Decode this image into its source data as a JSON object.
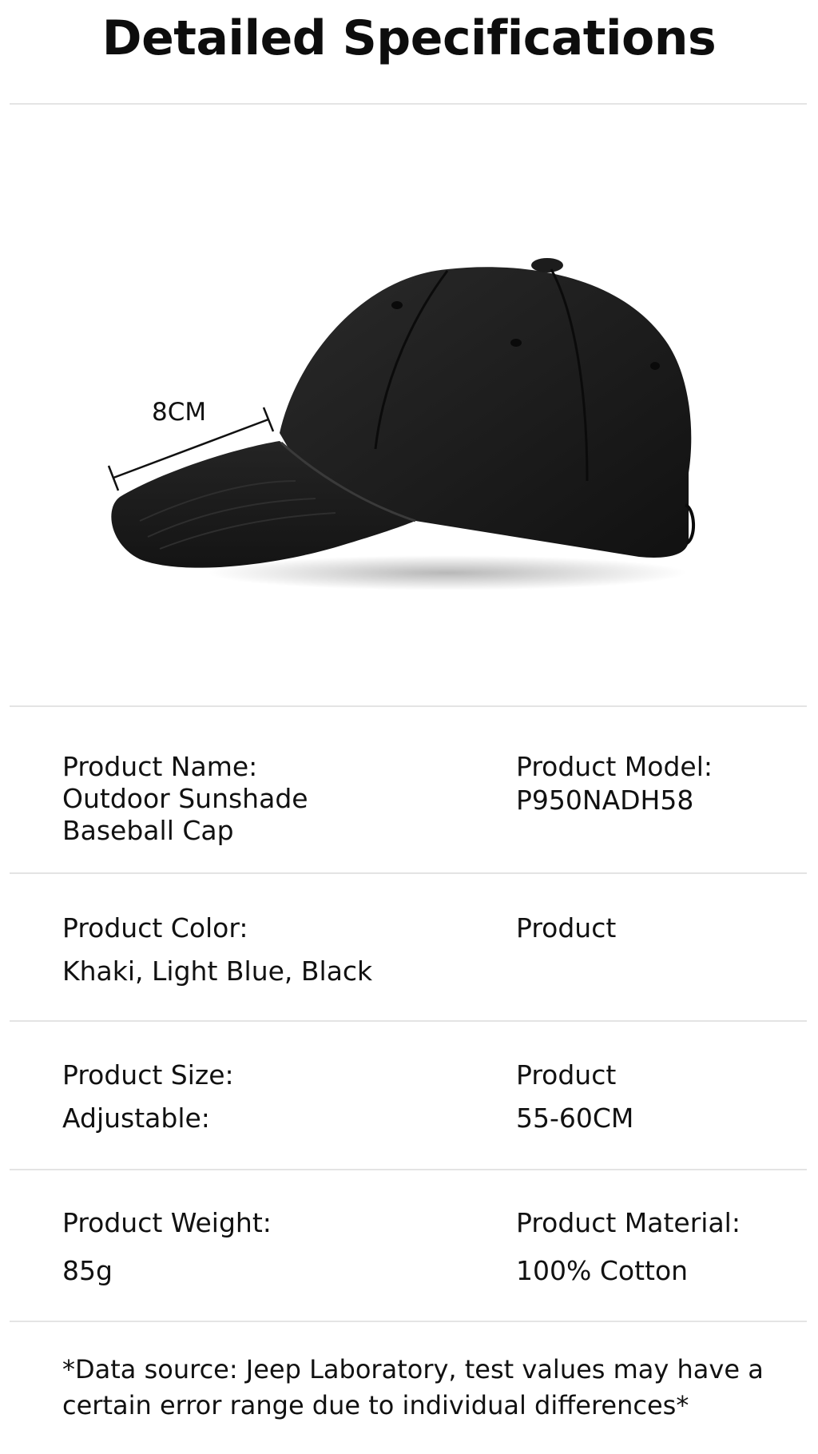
{
  "page": {
    "title": "Detailed Specifications"
  },
  "product_image": {
    "measurement_label": "8CM",
    "subject": "black-corduroy-baseball-cap"
  },
  "specs": [
    {
      "label": "Product Name:",
      "value": "Outdoor Sunshade\nBaseball Cap"
    },
    {
      "label": "Product Model:",
      "value": "P950NADH58"
    },
    {
      "label": "Product Color:",
      "value": "Khaki, Light Blue, Black"
    },
    {
      "label": "Product",
      "value": ""
    },
    {
      "label": "Product Size:",
      "value": "Adjustable:"
    },
    {
      "label": "Product",
      "value": "55-60CM"
    },
    {
      "label": "Product Weight:",
      "value": "85g"
    },
    {
      "label": "Product Material:",
      "value": "100% Cotton"
    }
  ],
  "footnote": {
    "text": "*Data source: Jeep Laboratory, test values may have a certain error range due to individual differences*"
  },
  "colors": {
    "text": "#111111",
    "divider": "#e4e4e4",
    "cap": "#1a1a1a"
  }
}
